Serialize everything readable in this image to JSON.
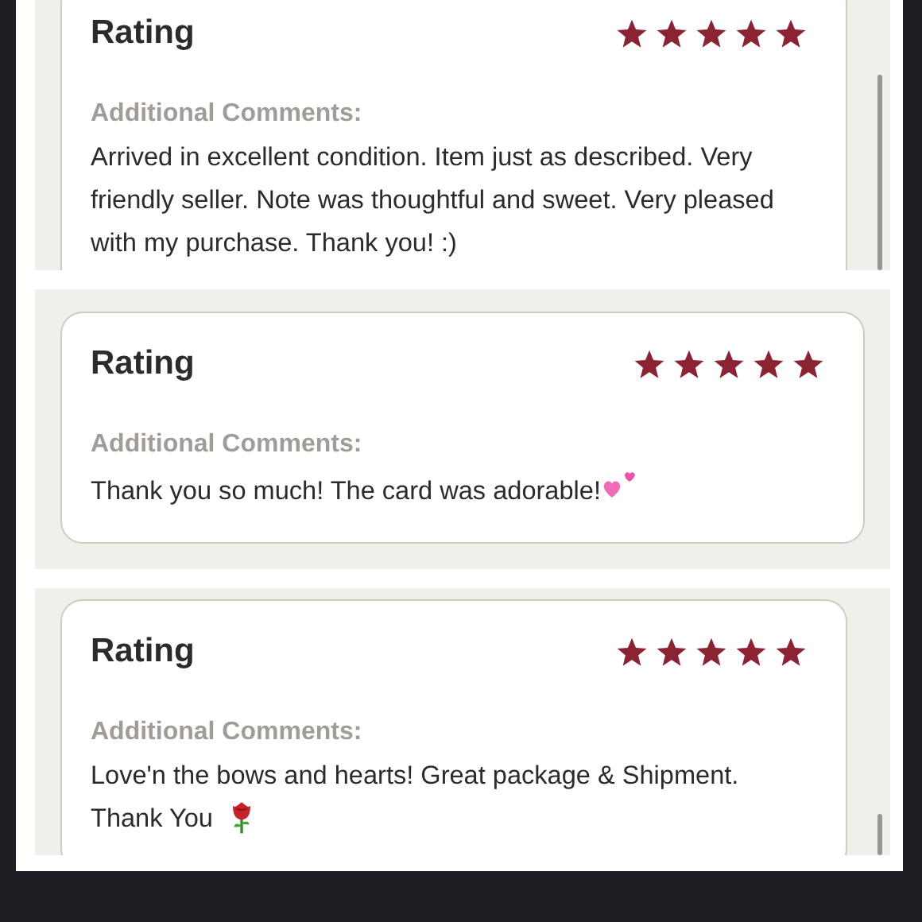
{
  "reviews": [
    {
      "heading": "Rating",
      "stars": 5,
      "comments_label": "Additional Comments:",
      "comment": "Arrived in excellent condition. Item just as described. Very friendly seller. Note was thoughtful and sweet. Very pleased with my purchase. Thank you! :)",
      "kind": "plain",
      "scrollable": true
    },
    {
      "heading": "Rating",
      "stars": 5,
      "comments_label": "Additional Comments:",
      "comment": "Thank you so much! The card was adorable!",
      "kind": "hearts",
      "scrollable": false
    },
    {
      "heading": "Rating",
      "stars": 5,
      "comments_label": "Additional Comments:",
      "comment": "Love'n the bows and hearts! Great package & Shipment. Thank You",
      "kind": "rose",
      "scrollable": true
    }
  ]
}
